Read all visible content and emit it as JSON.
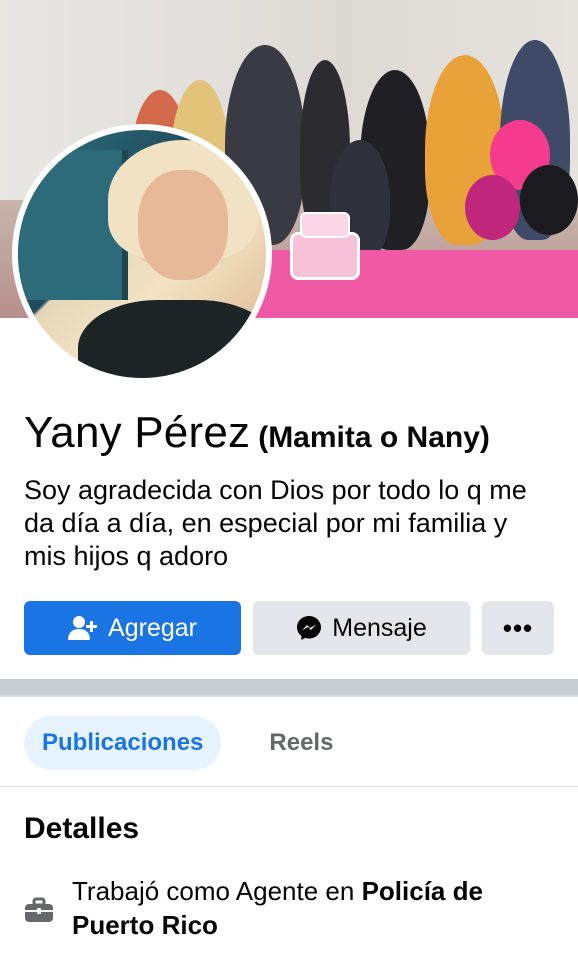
{
  "profile": {
    "name": "Yany Pérez",
    "alternate_name": "(Mamita o Nany)",
    "bio": "Soy agradecida con Dios por todo lo q me da día a día, en especial por mi familia y mis hijos q adoro"
  },
  "actions": {
    "add_label": "Agregar",
    "message_label": "Mensaje",
    "more_label": "•••"
  },
  "tabs": [
    {
      "label": "Publicaciones",
      "active": true
    },
    {
      "label": "Reels",
      "active": false
    }
  ],
  "details": {
    "title": "Detalles",
    "items": [
      {
        "icon": "briefcase-icon",
        "prefix": "Trabajó como Agente en ",
        "place": "Policía de Puerto Rico"
      }
    ]
  },
  "colors": {
    "primary": "#1b74e4",
    "secondary_button": "#e4e6eb",
    "active_tab_bg": "#e7f3ff",
    "muted_text": "#65676b"
  }
}
